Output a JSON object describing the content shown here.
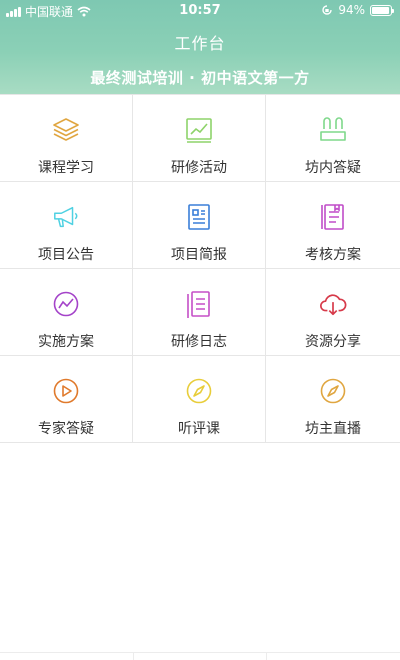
{
  "status_bar": {
    "carrier": "中国联通",
    "time": "10:57",
    "battery": "94%",
    "battery_level": 0.94,
    "icons": [
      "signal-icon",
      "wifi-icon",
      "rotation-lock-icon",
      "battery-icon"
    ]
  },
  "header": {
    "title": "工作台",
    "subtitle": "最终测试培训 · 初中语文第一方",
    "background_color": "#86cdb5"
  },
  "menu": [
    {
      "label": "课程学习",
      "icon": "layers-icon",
      "color": "#e0a640"
    },
    {
      "label": "研修活动",
      "icon": "chart-board-icon",
      "color": "#8ed36a"
    },
    {
      "label": "坊内答疑",
      "icon": "people-icon",
      "color": "#7ed88a"
    },
    {
      "label": "项目公告",
      "icon": "megaphone-icon",
      "color": "#4fd1e2"
    },
    {
      "label": "项目简报",
      "icon": "report-icon",
      "color": "#3a7fd8"
    },
    {
      "label": "考核方案",
      "icon": "notebook-icon",
      "color": "#c04cc8"
    },
    {
      "label": "实施方案",
      "icon": "trend-circle-icon",
      "color": "#a443c9"
    },
    {
      "label": "研修日志",
      "icon": "diary-icon",
      "color": "#c54fc7"
    },
    {
      "label": "资源分享",
      "icon": "cloud-download-icon",
      "color": "#d73a4a"
    },
    {
      "label": "专家答疑",
      "icon": "play-circle-icon",
      "color": "#e07a2c"
    },
    {
      "label": "听评课",
      "icon": "compass-icon",
      "color": "#e8cd3a"
    },
    {
      "label": "坊主直播",
      "icon": "compass-icon",
      "color": "#e0a640"
    }
  ]
}
